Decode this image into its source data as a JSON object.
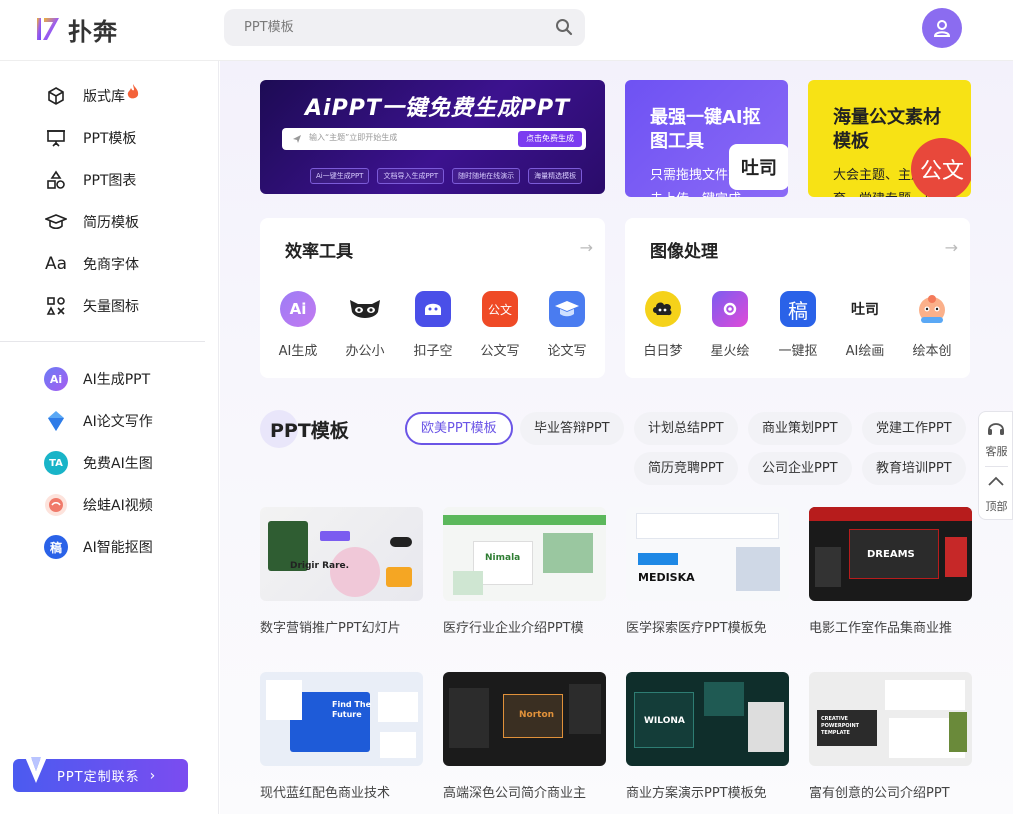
{
  "header": {
    "logo_text": "扑奔",
    "search": {
      "placeholder": "PPT模板",
      "value": ""
    }
  },
  "sidebar": {
    "items": [
      {
        "label": "版式库",
        "icon": "cube-icon",
        "badge": "fire-icon"
      },
      {
        "label": "PPT模板",
        "icon": "presentation-icon"
      },
      {
        "label": "PPT图表",
        "icon": "shapes-icon"
      },
      {
        "label": "简历模板",
        "icon": "graduation-cap-icon"
      },
      {
        "label": "免商字体",
        "icon": "font-icon",
        "icon_text": "Aa"
      },
      {
        "label": "矢量图标",
        "icon": "grid-icon"
      }
    ],
    "ai_items": [
      {
        "label": "AI生成PPT",
        "icon_text": "Ai",
        "color": "#7b5cf0"
      },
      {
        "label": "AI论文写作",
        "icon_text": "",
        "color": "#3a8ff0"
      },
      {
        "label": "免费AI生图",
        "icon_text": "TA",
        "color": "#19b4c8"
      },
      {
        "label": "绘蛙AI视频",
        "icon_text": "",
        "color": "#f07a6a"
      },
      {
        "label": "AI智能抠图",
        "icon_text": "稿",
        "color": "#2a62e8"
      }
    ],
    "custom_button": "PPT定制联系"
  },
  "banners": {
    "b1": {
      "title": "AiPPT一键免费生成PPT",
      "input_placeholder": "输入“主题”立即开始生成",
      "button": "点击免费生成",
      "chips": [
        "Ai一键生成PPT",
        "文档导入生成PPT",
        "随时随地在线演示",
        "海量精选模板"
      ]
    },
    "b2": {
      "title": "最强一键AI抠图工具",
      "subtitle": "只需拖拽文件或点击上传一键完成",
      "logo_text": "吐司"
    },
    "b3": {
      "title": "海量公文素材模板",
      "subtitle": "大会主题、主题教育、党建专题、周",
      "circle_text": "公文"
    }
  },
  "panels": {
    "efficiency": {
      "title": "效率工具",
      "tools": [
        {
          "label": "AI生成",
          "icon_text": "Ai",
          "color": "#8b6cf0"
        },
        {
          "label": "办公小",
          "icon_text": "",
          "color": "#ffffff"
        },
        {
          "label": "扣子空",
          "icon_text": "",
          "color": "#4a4fe8"
        },
        {
          "label": "公文写",
          "icon_text": "公文",
          "color": "#ef4a26"
        },
        {
          "label": "论文写",
          "icon_text": "",
          "color": "#4a7cf0"
        }
      ]
    },
    "image": {
      "title": "图像处理",
      "tools": [
        {
          "label": "白日梦",
          "icon_text": "",
          "color": "#f5d21a"
        },
        {
          "label": "星火绘",
          "icon_text": "",
          "color": "#9c5cf0"
        },
        {
          "label": "一键抠",
          "icon_text": "稿",
          "color": "#2a62e8"
        },
        {
          "label": "AI绘画",
          "icon_text": "吐司",
          "color": "#ffffff"
        },
        {
          "label": "绘本创",
          "icon_text": "",
          "color": "#ffffff"
        }
      ]
    }
  },
  "section": {
    "title": "PPT模板",
    "categories": [
      "欧美PPT模板",
      "毕业答辩PPT",
      "计划总结PPT",
      "商业策划PPT",
      "党建工作PPT",
      "简历竞聘PPT",
      "公司企业PPT",
      "教育培训PPT"
    ]
  },
  "cards": [
    {
      "name": "数字营销推广PPT幻灯片",
      "thumb_text": "Drigir Rare."
    },
    {
      "name": "医疗行业企业介绍PPT模",
      "thumb_text": "Nimala"
    },
    {
      "name": "医学探索医疗PPT模板免",
      "thumb_text": "MEDISKA"
    },
    {
      "name": "电影工作室作品集商业推",
      "thumb_text": "DREAMS"
    },
    {
      "name": "现代蓝红配色商业技术",
      "thumb_text": "Find The Future"
    },
    {
      "name": "高端深色公司简介商业主",
      "thumb_text": "Norton"
    },
    {
      "name": "商业方案演示PPT模板免",
      "thumb_text": "WILONA"
    },
    {
      "name": "富有创意的公司介绍PPT",
      "thumb_text": "CREATIVE POWERPOINT TEMPLATE"
    }
  ],
  "float_bar": {
    "service": "客服",
    "top": "顶部"
  }
}
